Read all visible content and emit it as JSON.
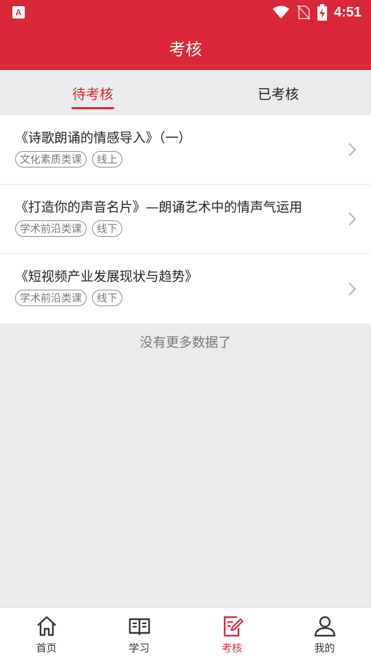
{
  "status_bar": {
    "time": "4:51",
    "app_badge": "A"
  },
  "header": {
    "title": "考核"
  },
  "tabs": [
    {
      "label": "待考核",
      "active": true
    },
    {
      "label": "已考核",
      "active": false
    }
  ],
  "courses": [
    {
      "title": "《诗歌朗诵的情感导入》（一）",
      "tags": [
        "文化素质类课",
        "线上"
      ]
    },
    {
      "title": "《打造你的声音名片》—朗诵艺术中的情声气运用",
      "tags": [
        "学术前沿类课",
        "线下"
      ]
    },
    {
      "title": "《短视频产业发展现状与趋势》",
      "tags": [
        "学术前沿类课",
        "线下"
      ]
    }
  ],
  "list_footer": "没有更多数据了",
  "bottom_nav": [
    {
      "label": "首页",
      "icon": "home-icon",
      "active": false
    },
    {
      "label": "学习",
      "icon": "book-icon",
      "active": false
    },
    {
      "label": "考核",
      "icon": "exam-icon",
      "active": true
    },
    {
      "label": "我的",
      "icon": "user-icon",
      "active": false
    }
  ],
  "colors": {
    "accent": "#da2838",
    "background": "#ebebed"
  }
}
